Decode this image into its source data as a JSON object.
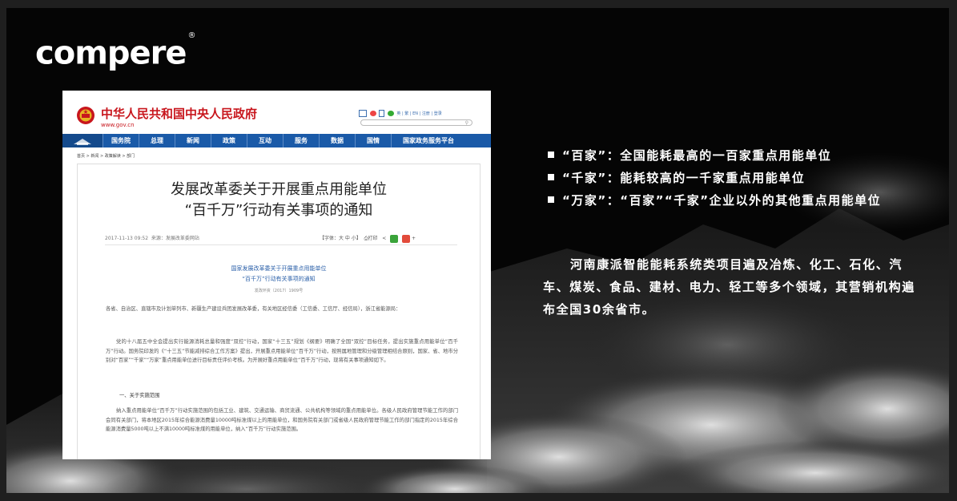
{
  "brand": {
    "logo_text": "compere",
    "registered_mark": "®"
  },
  "document": {
    "site_title": "中华人民共和国中央人民政府",
    "site_url": "www.gov.cn",
    "top_links": "英 | 繁 | EN | 注册 | 登录",
    "nav": [
      "国务院",
      "总理",
      "新闻",
      "政策",
      "互动",
      "服务",
      "数据",
      "国情",
      "国家政务服务平台"
    ],
    "breadcrumb": "首页 > 新闻 > 政策解读 > 部门",
    "article_title_line1": "发展改革委关于开展重点用能单位",
    "article_title_line2": "“百千万”行动有关事项的通知",
    "publish_time": "2017-11-13 09:52",
    "source": "来源：发展改革委网站",
    "font_size_label": "【字体：大 中 小】",
    "print_label": "打印",
    "sub_title_line1": "国家发展改革委关于开展重点用能单位",
    "sub_title_line2": "“百千万”行动有关事项的通知",
    "doc_number": "发改环资〔2017〕1909号",
    "para1": "各省、自治区、直辖市及计划单列市、新疆生产建设兵团发展改革委，有关地区经信委（工信委、工信厅、经信局），浙江省能源局：",
    "para2": "党的十八届五中全会提出实行能源消耗总量和强度“双控”行动，国家“十三五”规划《纲要》明确了全国“双控”目标任务，提出实施重点用能单位“百千万”行动。国务院印发的《“十三五”节能减排综合工作方案》提出，开展重点用能单位“百千万”行动，按照属地管理和分级管理相结合原则，国家、省、地市分别对“百家”“千家”“万家”重点用能单位进行目标责任评价考核。为开展好重点用能单位“百千万”行动，现将有关事项通知如下。",
    "section1": "一、关于实施范围",
    "para3": "纳入重点用能单位“百千万”行动实施范围的包括工业、建筑、交通运输、商贸流通、公共机构等领域的重点用能单位。各级人民政府管理节能工作的部门会同有关部门，将本地区2015年综合能源消费量10000吨标准煤以上的用能单位，和国务院有关部门或省级人民政府管理节能工作的部门指定的2015年综合能源消费量5000吨以上不满10000吨标准煤的用能单位，纳入“百千万”行动实施范围。"
  },
  "bullets": [
    "“百家”：全国能耗最高的一百家重点用能单位",
    "“千家”：能耗较高的一千家重点用能单位",
    "“万家”：“百家”“千家”企业以外的其他重点用能单位"
  ],
  "description": "河南康派智能能耗系统类项目遍及冶炼、化工、石化、汽车、煤炭、食品、建材、电力、轻工等多个领域，其营销机构遍布全国30余省市。",
  "colors": {
    "gov_red": "#c8161d",
    "nav_blue": "#1a5aa8",
    "slide_bg": "#050505"
  }
}
